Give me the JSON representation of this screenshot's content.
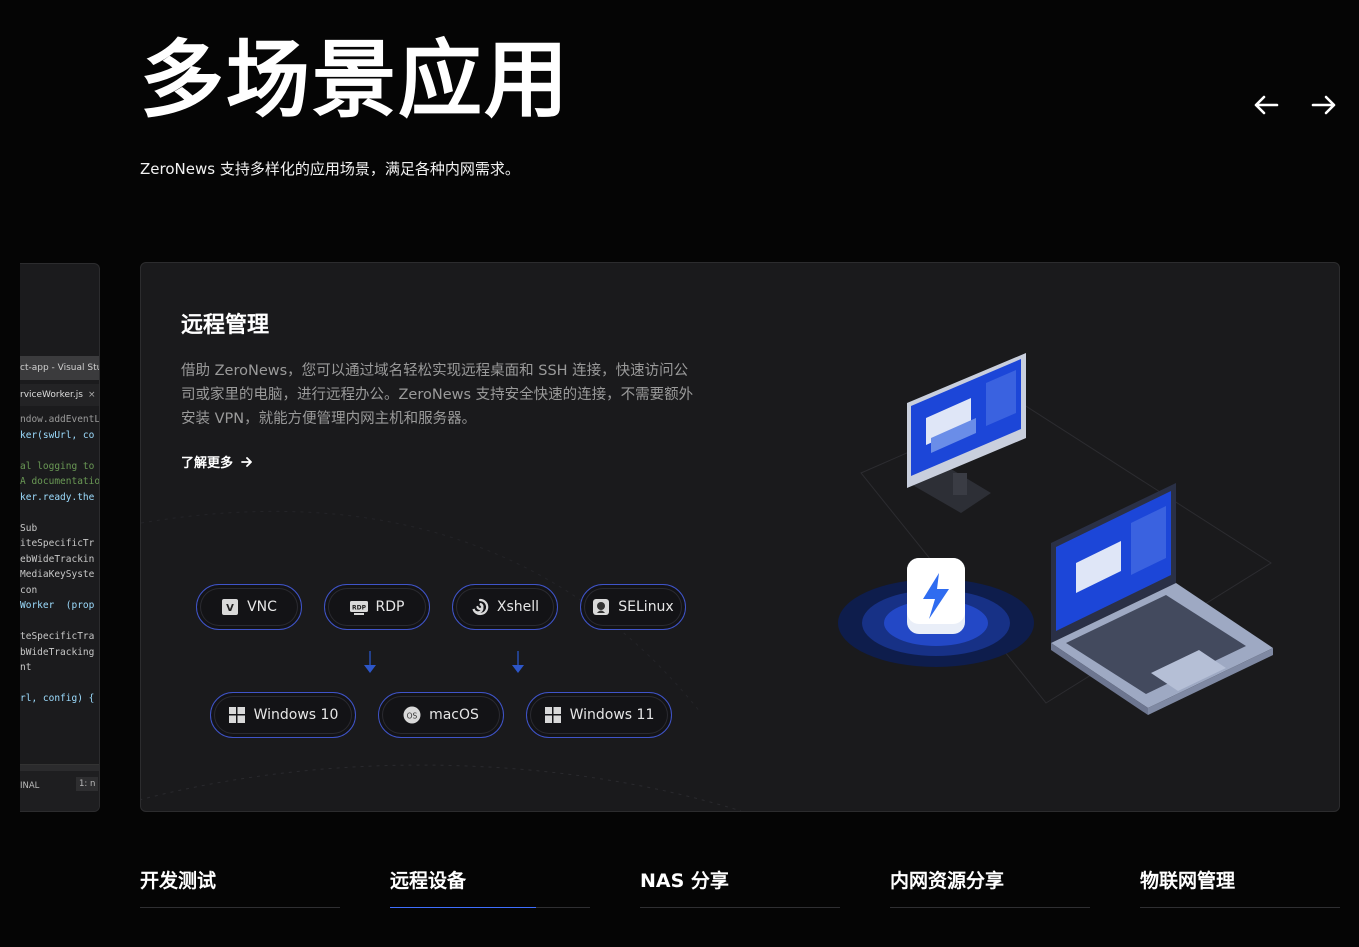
{
  "hero": {
    "title": "多场景应用",
    "subtitle": "ZeroNews 支持多样化的应用场景，满足各种内网需求。"
  },
  "carousel": {
    "prev_icon": "arrow-left-icon",
    "next_icon": "arrow-right-icon"
  },
  "side_card": {
    "editor_title": "ct-app - Visual Stud",
    "file_tab": "rviceWorker.js",
    "close_glyph": "×",
    "code_lines": [
      {
        "text": "ndow.addEventLis",
        "color": "#9a9a9a"
      },
      {
        "text": "ker(swUrl, co",
        "color": "#9cdcfe"
      },
      {
        "text": "",
        "color": "#9a9a9a"
      },
      {
        "text": "al logging to",
        "color": "#6a9955"
      },
      {
        "text": "A documentatio",
        "color": "#6a9955"
      },
      {
        "text": "ker.ready.the",
        "color": "#9cdcfe"
      },
      {
        "text": "",
        "color": "#9a9a9a"
      },
      {
        "text": "Sub",
        "color": "#c8c8c8"
      },
      {
        "text": "iteSpecificTr",
        "color": "#c8c8c8"
      },
      {
        "text": "ebWideTrackin",
        "color": "#c8c8c8"
      },
      {
        "text": "MediaKeySyste",
        "color": "#c8c8c8"
      },
      {
        "text": "con",
        "color": "#c8c8c8"
      },
      {
        "text": "Worker  (prop",
        "color": "#9cdcfe"
      },
      {
        "text": "",
        "color": "#9a9a9a"
      },
      {
        "text": "teSpecificTra",
        "color": "#c8c8c8"
      },
      {
        "text": "bWideTracking",
        "color": "#c8c8c8"
      },
      {
        "text": "nt",
        "color": "#c8c8c8"
      },
      {
        "text": "",
        "color": "#9a9a9a"
      },
      {
        "text": "rl, config) {",
        "color": "#9cdcfe"
      }
    ],
    "terminal_label": "INAL",
    "terminal_tab": "1: n"
  },
  "card": {
    "title": "远程管理",
    "description": "借助 ZeroNews，您可以通过域名轻松实现远程桌面和 SSH 连接，快速访问公司或家里的电脑，进行远程办公。ZeroNews 支持安全快速的连接，不需要额外安装 VPN，就能方便管理内网主机和服务器。",
    "learn_more": "了解更多",
    "tools": [
      {
        "label": "VNC",
        "icon": "vnc-icon"
      },
      {
        "label": "RDP",
        "icon": "rdp-icon"
      },
      {
        "label": "Xshell",
        "icon": "xshell-icon"
      },
      {
        "label": "SELinux",
        "icon": "selinux-icon"
      }
    ],
    "platforms": [
      {
        "label": "Windows 10",
        "icon": "windows-icon"
      },
      {
        "label": "macOS",
        "icon": "macos-icon"
      },
      {
        "label": "Windows 11",
        "icon": "windows-icon"
      }
    ],
    "illustration": "remote-desktop-illustration",
    "accent_color": "#3f54c9"
  },
  "tabs": [
    {
      "label": "开发测试",
      "active": false
    },
    {
      "label": "远程设备",
      "active": true
    },
    {
      "label": "NAS 分享",
      "active": false
    },
    {
      "label": "内网资源分享",
      "active": false
    },
    {
      "label": "物联网管理",
      "active": false
    }
  ]
}
